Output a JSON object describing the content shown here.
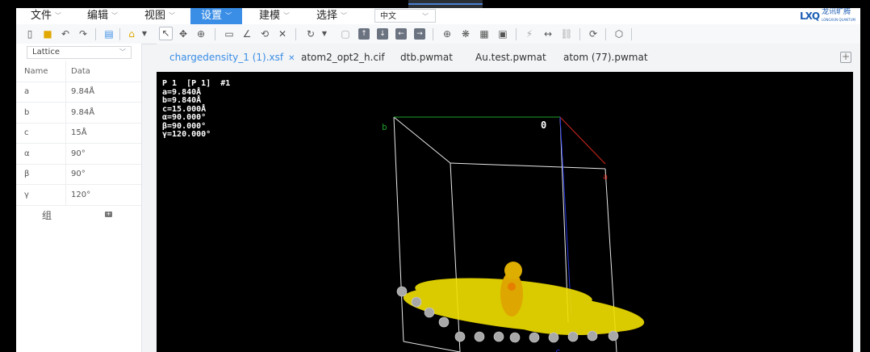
{
  "menu": {
    "file": "文件",
    "edit": "编辑",
    "view": "视图",
    "settings": "设置",
    "modeling": "建模",
    "select": "选择",
    "language": "中文"
  },
  "logo": {
    "mark": "LXQ",
    "text": "龙讯旷腾",
    "sub": "LONGXUN QUANTUM"
  },
  "sidebar": {
    "dropdown_value": "Lattice",
    "columns": [
      "Name",
      "Data"
    ],
    "rows": [
      {
        "name": "a",
        "data": "9.84Å"
      },
      {
        "name": "b",
        "data": "9.84Å"
      },
      {
        "name": "c",
        "data": "15Å"
      },
      {
        "name": "α",
        "data": "90°"
      },
      {
        "name": "β",
        "data": "90°"
      },
      {
        "name": "γ",
        "data": "120°"
      }
    ],
    "group_label": "组"
  },
  "tabs": [
    {
      "label": "chargedensity_1 (1).xsf",
      "active": true
    },
    {
      "label": "atom2_opt2_h.cif"
    },
    {
      "label": "dtb.pwmat"
    },
    {
      "label": "Au.test.pwmat"
    },
    {
      "label": "atom (77).pwmat"
    }
  ],
  "viewer": {
    "info_lines": [
      "P 1  [P 1]  #1",
      "a=9.840Å",
      "b=9.840Å",
      "c=15.000Å",
      "α=90.000°",
      "β=90.000°",
      "γ=120.000°"
    ],
    "axis_labels": {
      "origin": "0",
      "b": "b",
      "a": "a",
      "c": "c"
    }
  },
  "colors": {
    "accent": "#3a8ee6",
    "density": "#f2e000",
    "atom": "#a8a8a8"
  }
}
